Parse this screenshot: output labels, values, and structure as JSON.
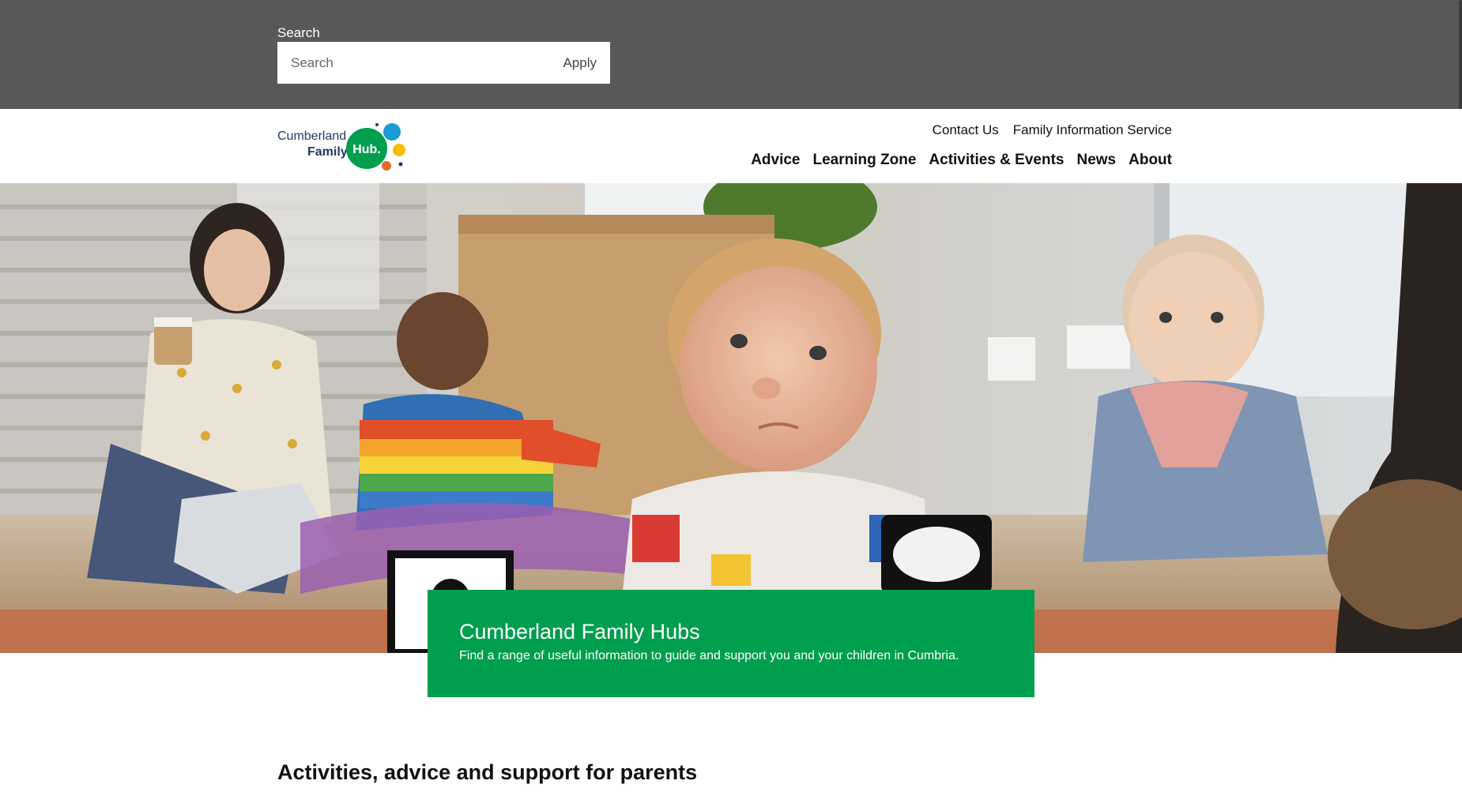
{
  "search": {
    "label": "Search",
    "placeholder": "Search",
    "value": "",
    "apply_label": "Apply"
  },
  "logo": {
    "line1": "Cumberland",
    "line2": "Family",
    "badge": "Hub."
  },
  "utility_nav": [
    {
      "label": "Contact Us"
    },
    {
      "label": "Family Information Service"
    }
  ],
  "main_nav": [
    {
      "label": "Advice"
    },
    {
      "label": "Learning Zone"
    },
    {
      "label": "Activities & Events"
    },
    {
      "label": "News"
    },
    {
      "label": "About"
    }
  ],
  "hero": {
    "title": "Cumberland Family Hubs",
    "subtitle": "Find a range of useful information to guide and support you and your children in Cumbria.",
    "card_color": "#009e4f"
  },
  "section": {
    "heading": "Activities, advice and support for parents"
  },
  "colors": {
    "search_band": "#58585b",
    "brand_green": "#009e4f",
    "logo_blue": "#1a9ad6",
    "logo_yellow": "#f6c000",
    "logo_orange": "#e2682a",
    "logo_navy": "#1d3a6b"
  }
}
